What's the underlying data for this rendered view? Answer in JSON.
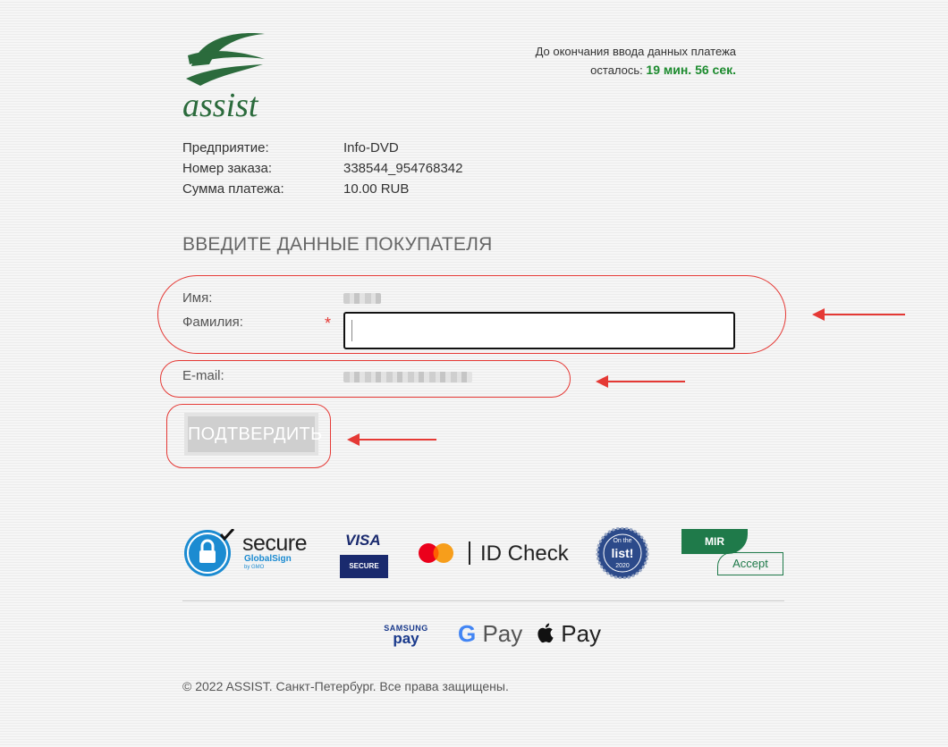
{
  "logo": {
    "text": "assist",
    "color": "#2b6b3c"
  },
  "timer": {
    "line1": "До окончания ввода данных платежа",
    "line2_prefix": "осталось:",
    "remaining": "19 мин. 56 сек."
  },
  "order": [
    {
      "key": "Предприятие:",
      "value": "Info-DVD"
    },
    {
      "key": "Номер заказа:",
      "value": "338544_954768342"
    },
    {
      "key": "Сумма платежа:",
      "value": "10.00 RUB"
    }
  ],
  "form": {
    "title": "ВВЕДИТЕ ДАННЫЕ ПОКУПАТЕЛЯ",
    "first_name_label": "Имя:",
    "last_name_label": "Фамилия:",
    "required_mark": "*",
    "last_name_value": "",
    "email_label": "E-mail:",
    "submit_label": "ПОДТВЕРДИТЬ"
  },
  "badges": {
    "secure_title": "secure",
    "secure_sub": "GlobalSign",
    "secure_sub2": "by GMO",
    "visa_word": "VISA",
    "visa_box": "SECURE",
    "mc_idcheck": "ID Check",
    "list_badge_top": "On the",
    "list_badge_mid": "list!",
    "list_badge_year": "2020",
    "mir_label": "MIR",
    "mir_accept": "Accept"
  },
  "wallets": {
    "samsung_top": "SAMSUNG",
    "samsung_bottom": "pay",
    "gpay_g": "G",
    "gpay_pay": "Pay",
    "applepay_pay": "Pay"
  },
  "footer": {
    "copyright": "© 2022 ASSIST. Санкт-Петербург. Все права защищены."
  },
  "colors": {
    "accent_red": "#e53935",
    "timer_green": "#1d8b2f",
    "brand_green": "#2b6b3c"
  }
}
